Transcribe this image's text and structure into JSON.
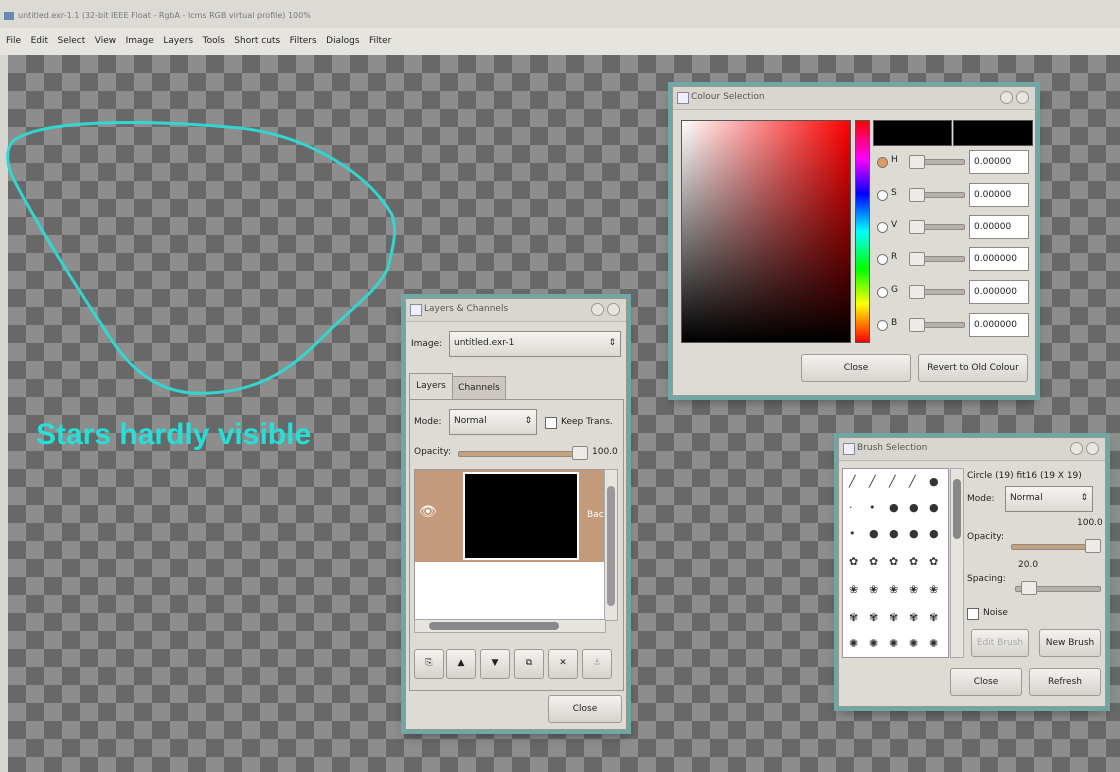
{
  "window": {
    "title": "untitled.exr-1.1 (32-bit IEEE Float - RgbA - lcms RGB virtual profile) 100%"
  },
  "menu": [
    "File",
    "Edit",
    "Select",
    "View",
    "Image",
    "Layers",
    "Tools",
    "Short cuts",
    "Filters",
    "Dialogs",
    "Filter"
  ],
  "canvas": {
    "annotation": "Stars hardly visible",
    "annotation_color": "#25e0d8"
  },
  "colour_selection": {
    "title": "Colour Selection",
    "channels": [
      {
        "label": "H",
        "value": "0.00000",
        "selected": true
      },
      {
        "label": "S",
        "value": "0.00000",
        "selected": false
      },
      {
        "label": "V",
        "value": "0.00000",
        "selected": false
      },
      {
        "label": "R",
        "value": "0.000000",
        "selected": false
      },
      {
        "label": "G",
        "value": "0.000000",
        "selected": false
      },
      {
        "label": "B",
        "value": "0.000000",
        "selected": false
      }
    ],
    "close_label": "Close",
    "revert_label": "Revert to Old Colour"
  },
  "layers": {
    "title": "Layers & Channels",
    "image_label": "Image:",
    "image_value": "untitled.exr-1",
    "tabs": [
      "Layers",
      "Channels"
    ],
    "mode_label": "Mode:",
    "mode_value": "Normal",
    "keep_trans_label": "Keep Trans.",
    "opacity_label": "Opacity:",
    "opacity_value": "100.0",
    "layer_name": "Bac",
    "close_label": "Close"
  },
  "brush": {
    "title": "Brush Selection",
    "brush_name": "Circle (19) fit16  (19 X 19)",
    "mode_label": "Mode:",
    "mode_value": "Normal",
    "opacity_value": "100.0",
    "opacity_label": "Opacity:",
    "spacing_value": "20.0",
    "spacing_label": "Spacing:",
    "noise_label": "Noise",
    "edit_brush_label": "Edit Brush",
    "new_brush_label": "New Brush",
    "close_label": "Close",
    "refresh_label": "Refresh"
  }
}
